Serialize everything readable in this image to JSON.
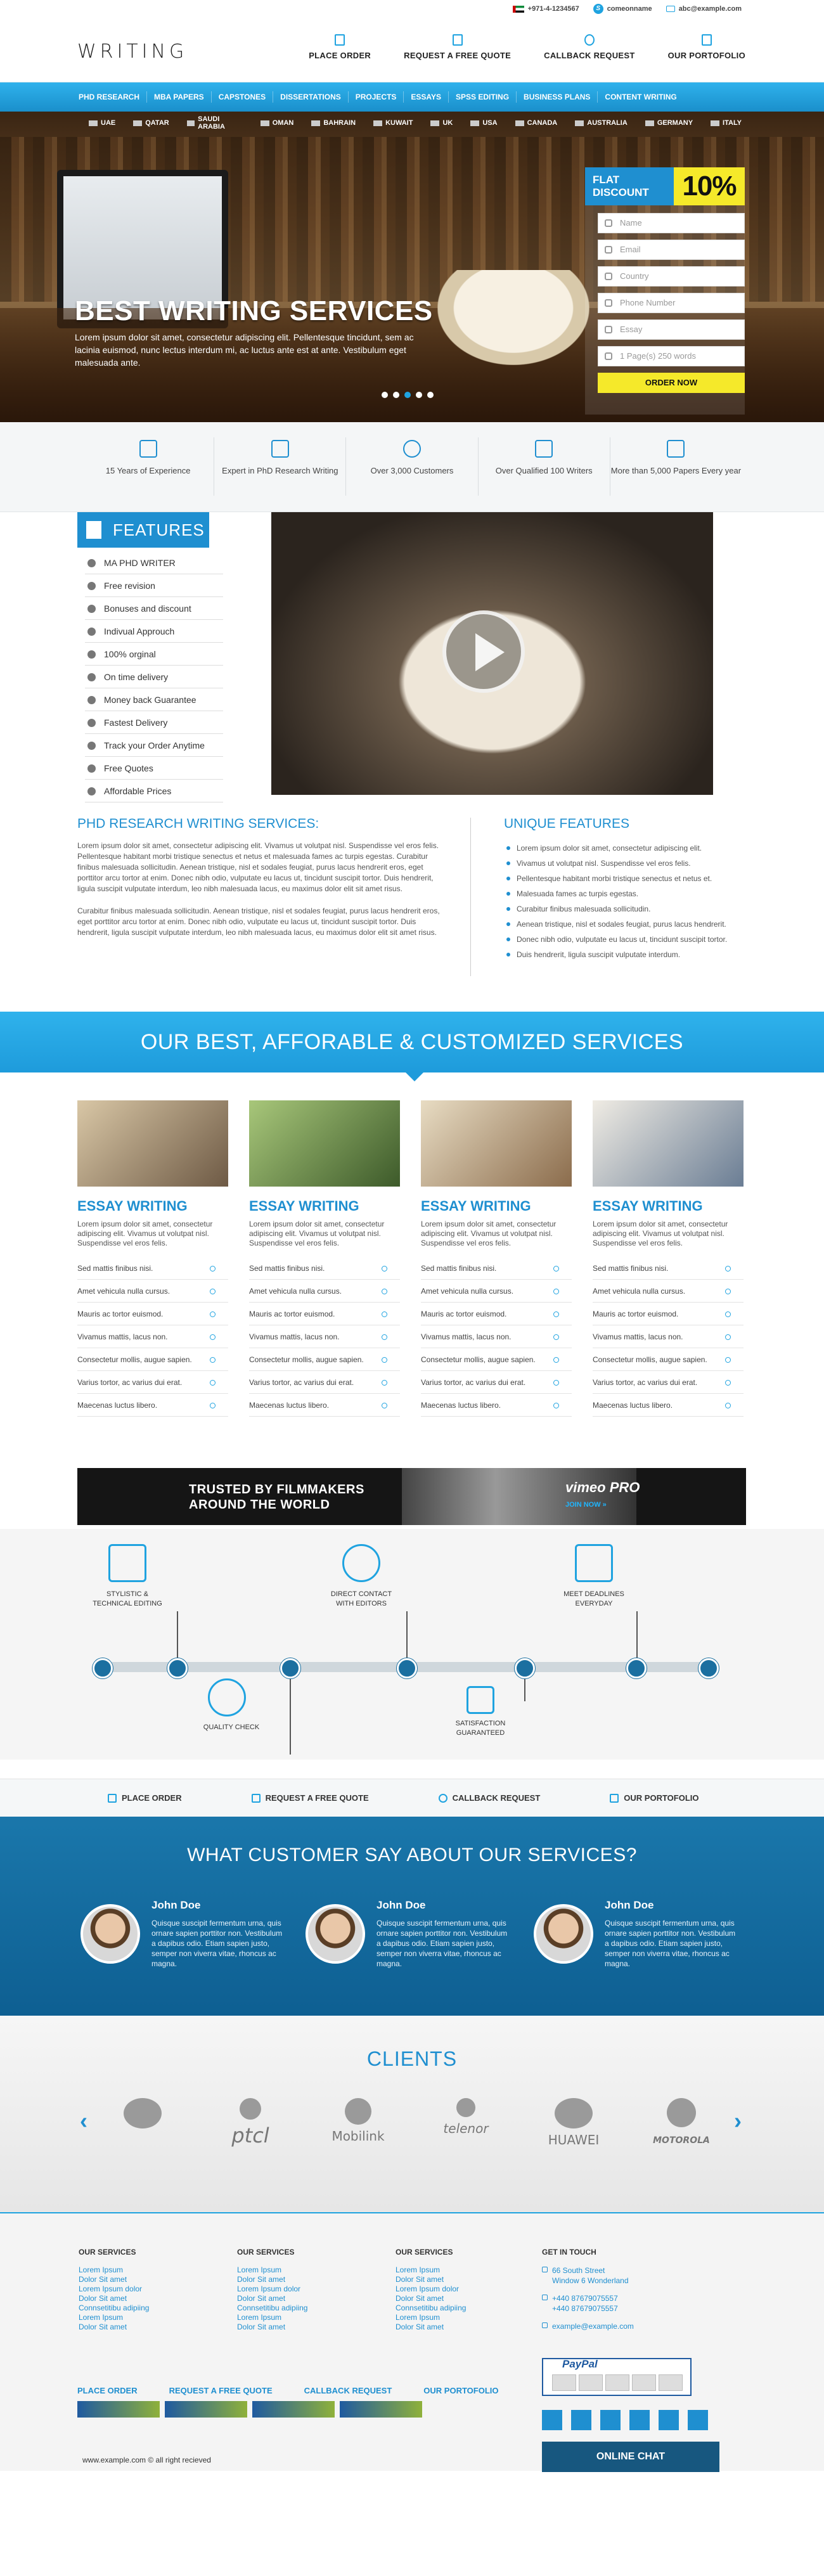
{
  "topbar": {
    "phone": "+971-4-1234567",
    "skype": "comeonname",
    "email": "abc@example.com"
  },
  "header": {
    "logo": "WRITING",
    "nav": [
      {
        "label": "PLACE ORDER"
      },
      {
        "label": "REQUEST A FREE QUOTE"
      },
      {
        "label": "CALLBACK REQUEST"
      },
      {
        "label": "OUR PORTOFOLIO"
      }
    ]
  },
  "menu": [
    "PHD RESEARCH",
    "MBA PAPERS",
    "CAPSTONES",
    "DISSERTATIONS",
    "PROJECTS",
    "ESSAYS",
    "SPSS EDITING",
    "BUSINESS PLANS",
    "CONTENT WRITING"
  ],
  "hero": {
    "countries": [
      "UAE",
      "QATAR",
      "SAUDI ARABIA",
      "OMAN",
      "BAHRAIN",
      "KUWAIT",
      "UK",
      "USA",
      "CANADA",
      "AUSTRALIA",
      "GERMANY",
      "ITALY"
    ],
    "title": "BEST WRITING SERVICES",
    "desc": "Lorem ipsum dolor sit amet, consectetur adipiscing elit. Pellentesque tincidunt, sem ac lacinia euismod, nunc lectus interdum mi, ac luctus ante est at ante. Vestibulum eget malesuada ante.",
    "form": {
      "flat": "FLAT",
      "discount": "DISCOUNT",
      "percent": "10%",
      "name": "Name",
      "email": "Email",
      "country": "Country",
      "phone": "Phone Number",
      "essay": "Essay",
      "pages": "1 Page(s) 250 words",
      "order": "ORDER NOW"
    }
  },
  "stats": [
    {
      "label": "15 Years of Experience"
    },
    {
      "label": "Expert in PhD Research Writing"
    },
    {
      "label": "Over 3,000 Customers"
    },
    {
      "label": "Over Qualified 100 Writers"
    },
    {
      "label": "More than 5,000 Papers Every year"
    }
  ],
  "features": {
    "title": "FEATURES",
    "items": [
      "MA PHD WRITER",
      "Free revision",
      "Bonuses and discount",
      "Indivual Approuch",
      "100% orginal",
      "On time delivery",
      "Money back Guarantee",
      "Fastest Delivery",
      "Track your Order Anytime",
      "Free Quotes",
      "Affordable Prices"
    ]
  },
  "phd": {
    "title": "PHD RESEARCH WRITING SERVICES:",
    "p1": "Lorem ipsum dolor sit amet, consectetur adipiscing elit. Vivamus ut volutpat nisl. Suspendisse vel eros felis. Pellentesque habitant morbi tristique senectus et netus et malesuada fames ac turpis egestas. Curabitur finibus malesuada sollicitudin. Aenean tristique, nisl et sodales feugiat, purus lacus hendrerit eros, eget porttitor arcu tortor at enim. Donec nibh odio, vulputate eu lacus ut, tincidunt suscipit tortor. Duis hendrerit, ligula suscipit vulputate interdum, leo nibh malesuada lacus, eu maximus dolor elit sit amet risus.",
    "p2": "Curabitur finibus malesuada sollicitudin. Aenean tristique, nisl et sodales feugiat, purus lacus hendrerit eros, eget porttitor arcu tortor at enim. Donec nibh odio, vulputate eu lacus ut, tincidunt suscipit tortor. Duis hendrerit, ligula suscipit vulputate interdum, leo nibh malesuada lacus, eu maximus dolor elit sit amet risus."
  },
  "unique": {
    "title": "UNIQUE FEATURES",
    "items": [
      "Lorem ipsum dolor sit amet, consectetur adipiscing elit.",
      "Vivamus ut volutpat nisl. Suspendisse vel eros felis.",
      "Pellentesque habitant morbi tristique senectus et netus et.",
      "Malesuada fames ac turpis egestas.",
      "Curabitur finibus malesuada sollicitudin.",
      "Aenean tristique, nisl et sodales feugiat, purus lacus hendrerit.",
      "Donec nibh odio, vulputate eu lacus ut, tincidunt suscipit tortor.",
      "Duis hendrerit, ligula suscipit vulputate interdum."
    ]
  },
  "services": {
    "banner": "OUR BEST, AFFORABLE & CUSTOMIZED SERVICES",
    "card_title": "ESSAY WRITING",
    "card_text": "Lorem ipsum dolor sit amet, consectetur adipiscing elit. Vivamus ut volutpat nisl. Suspendisse vel eros felis.",
    "card_items": [
      "Sed mattis finibus nisi.",
      "Amet vehicula nulla cursus.",
      "Mauris ac tortor euismod.",
      "Vivamus mattis, lacus non.",
      "Consectetur mollis, augue sapien.",
      "Varius tortor, ac varius dui erat.",
      "Maecenas luctus libero."
    ]
  },
  "vimeo": {
    "line1": "TRUSTED BY FILMMAKERS",
    "line2": "AROUND THE WORLD",
    "brand": "vimeo PRO",
    "join": "JOIN NOW »"
  },
  "timeline": {
    "top": [
      {
        "label": "STYLISTIC &\nTECHNICAL EDITING"
      },
      {
        "label": "DIRECT CONTACT\nWITH EDITORS"
      },
      {
        "label": "MEET DEADLINES\nEVERYDAY"
      }
    ],
    "bottom": [
      {
        "label": "QUALITY CHECK"
      },
      {
        "label": "SATISFACTION\nGUARANTEED"
      }
    ]
  },
  "bottomnav": [
    "PLACE ORDER",
    "REQUEST A FREE QUOTE",
    "CALLBACK REQUEST",
    "OUR PORTOFOLIO"
  ],
  "testimonials": {
    "title": "WHAT CUSTOMER SAY ABOUT OUR SERVICES?",
    "items": [
      {
        "name": "John Doe",
        "text": "Quisque suscipit fermentum urna, quis ornare sapien porttitor non. Vestibulum a dapibus odio. Etiam sapien justo, semper non viverra vitae, rhoncus ac magna."
      },
      {
        "name": "John Doe",
        "text": "Quisque suscipit fermentum urna, quis ornare sapien porttitor non. Vestibulum a dapibus odio. Etiam sapien justo, semper non viverra vitae, rhoncus ac magna."
      },
      {
        "name": "John Doe",
        "text": "Quisque suscipit fermentum urna, quis ornare sapien porttitor non. Vestibulum a dapibus odio. Etiam sapien justo, semper non viverra vitae, rhoncus ac magna."
      }
    ]
  },
  "clients": {
    "title": "CLIENTS",
    "logos": [
      "",
      "ptcl",
      "Mobilink",
      "telenor",
      "HUAWEI",
      "MOTOROLA"
    ]
  },
  "footer": {
    "cols": [
      {
        "title": "OUR SERVICES",
        "items": [
          "Lorem Ipsum",
          "Dolor Sit amet",
          "Lorem Ipsum dolor",
          "Dolor Sit amet",
          "Connsetitibu adipiing",
          "Lorem Ipsum",
          "Dolor Sit amet"
        ]
      },
      {
        "title": "OUR SERVICES",
        "items": [
          "Lorem Ipsum",
          "Dolor Sit amet",
          "Lorem Ipsum dolor",
          "Dolor Sit amet",
          "Connsetitibu adipiing",
          "Lorem Ipsum",
          "Dolor Sit amet"
        ]
      },
      {
        "title": "OUR SERVICES",
        "items": [
          "Lorem Ipsum",
          "Dolor Sit amet",
          "Lorem Ipsum dolor",
          "Dolor Sit amet",
          "Connsetitibu adipiing",
          "Lorem Ipsum",
          "Dolor Sit amet"
        ]
      }
    ],
    "contact": {
      "title": "GET IN TOUCH",
      "address1": "66 South Street",
      "address2": "Window 6 Wonderland",
      "phone1": "+440 87679075557",
      "phone2": "+440 87679075557",
      "email": "example@example.com"
    },
    "links": [
      "PLACE ORDER",
      "REQUEST A FREE QUOTE",
      "CALLBACK REQUEST",
      "OUR PORTOFOLIO"
    ],
    "paypal": "PayPal",
    "copyright": "www.example.com © all right recieved",
    "chat": "ONLINE CHAT"
  }
}
